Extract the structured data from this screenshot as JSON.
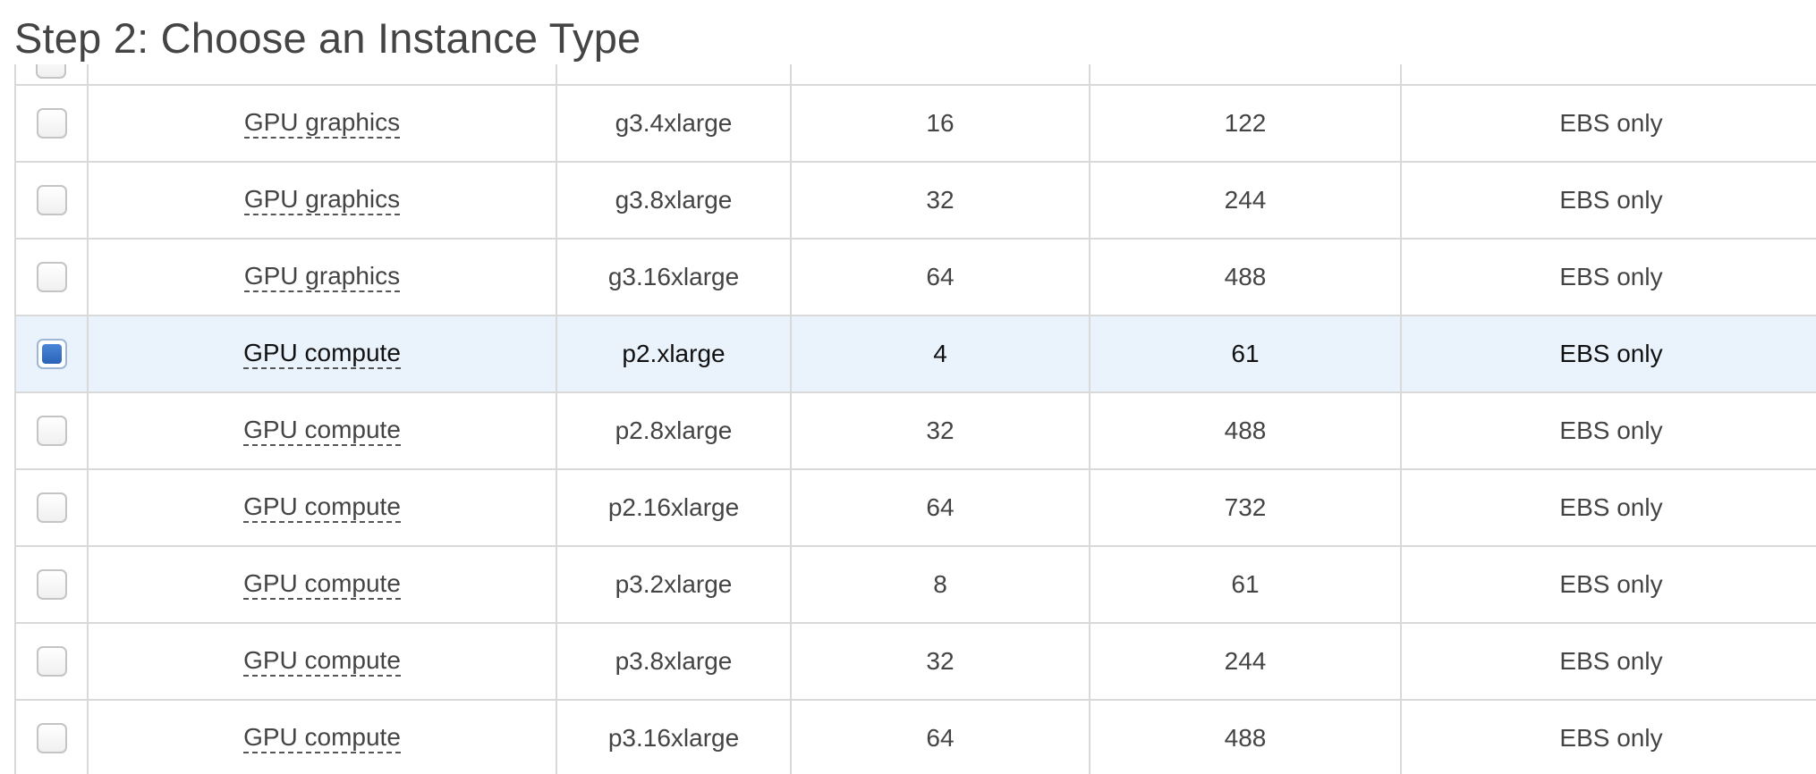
{
  "page": {
    "title": "Step 2: Choose an Instance Type"
  },
  "rows": [
    {
      "family": "GPU graphics",
      "type": "g3.4xlarge",
      "vcpus": "16",
      "memory": "122",
      "storage": "EBS only",
      "selected": false
    },
    {
      "family": "GPU graphics",
      "type": "g3.8xlarge",
      "vcpus": "32",
      "memory": "244",
      "storage": "EBS only",
      "selected": false
    },
    {
      "family": "GPU graphics",
      "type": "g3.16xlarge",
      "vcpus": "64",
      "memory": "488",
      "storage": "EBS only",
      "selected": false
    },
    {
      "family": "GPU compute",
      "type": "p2.xlarge",
      "vcpus": "4",
      "memory": "61",
      "storage": "EBS only",
      "selected": true
    },
    {
      "family": "GPU compute",
      "type": "p2.8xlarge",
      "vcpus": "32",
      "memory": "488",
      "storage": "EBS only",
      "selected": false
    },
    {
      "family": "GPU compute",
      "type": "p2.16xlarge",
      "vcpus": "64",
      "memory": "732",
      "storage": "EBS only",
      "selected": false
    },
    {
      "family": "GPU compute",
      "type": "p3.2xlarge",
      "vcpus": "8",
      "memory": "61",
      "storage": "EBS only",
      "selected": false
    },
    {
      "family": "GPU compute",
      "type": "p3.8xlarge",
      "vcpus": "32",
      "memory": "244",
      "storage": "EBS only",
      "selected": false
    },
    {
      "family": "GPU compute",
      "type": "p3.16xlarge",
      "vcpus": "64",
      "memory": "488",
      "storage": "EBS only",
      "selected": false
    }
  ],
  "colors": {
    "selected_row_bg": "#eaf2fc",
    "border": "#d9d9d9",
    "checkbox_fill": "#2a63b8"
  }
}
